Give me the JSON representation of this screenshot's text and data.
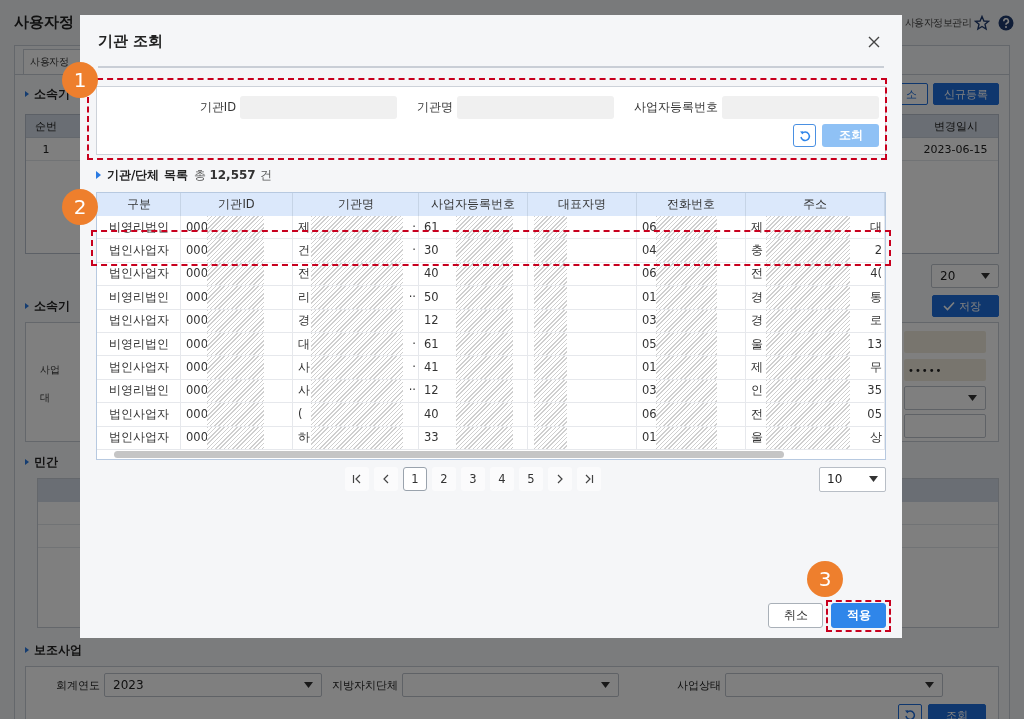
{
  "page": {
    "title": "사용자정",
    "breadcrumb": "사용자정보관리",
    "tab": {
      "label": "사용자정",
      "selected": true
    },
    "org_section": {
      "heading": "소속기",
      "buttons": [
        "소",
        "신규등록"
      ],
      "columns": [
        "순번",
        "변경일시"
      ],
      "row": [
        "1",
        "2023-06-15"
      ],
      "page_size": "20"
    },
    "detail_section": {
      "heading": "소속기",
      "save": "저장",
      "labels": [
        "사업",
        "대"
      ],
      "masked_value": "•••••"
    },
    "private_section": {
      "heading": "민간"
    },
    "subsidy_section": {
      "heading": "보조사업",
      "filters": [
        {
          "label": "회계연도",
          "value": "2023"
        },
        {
          "label": "지방자치단체"
        },
        {
          "label": "사업상태"
        }
      ],
      "search": "조회"
    }
  },
  "dialog": {
    "title": "기관 조회",
    "search": {
      "fields": [
        {
          "label": "기관ID"
        },
        {
          "label": "기관명"
        },
        {
          "label": "사업자등록번호"
        }
      ],
      "search_button": {
        "label": "조회",
        "disabled": true
      }
    },
    "list": {
      "heading": "기관/단체 목록",
      "total": "총 **12,557** 건",
      "columns": [
        "구분",
        "기관ID",
        "기관명",
        "사업자등록번호",
        "대표자명",
        "전화번호",
        "주소"
      ],
      "rows": [
        {
          "type": "비영리법인",
          "org_id": "000",
          "org_name": "제",
          "org_name_end": "·",
          "biz_no": "61",
          "phone": "06",
          "address": "제",
          "address_end": "대"
        },
        {
          "type": "법인사업자",
          "org_id": "000",
          "org_name": "건",
          "org_name_end": "·",
          "biz_no": "30",
          "phone": "04",
          "address": "충",
          "address_end": "2"
        },
        {
          "type": "법인사업자",
          "org_id": "000",
          "org_name": "전",
          "biz_no": "40",
          "phone": "06",
          "address": "전",
          "address_end": "4("
        },
        {
          "type": "비영리법인",
          "org_id": "000",
          "org_name": "리",
          "org_name_end": "··",
          "biz_no": "50",
          "phone": "01",
          "address": "경",
          "address_end": "통"
        },
        {
          "type": "법인사업자",
          "org_id": "000",
          "org_name": "경",
          "biz_no": "12",
          "phone": "03",
          "address": "경",
          "address_end": "로"
        },
        {
          "type": "비영리법인",
          "org_id": "000",
          "org_name": "대",
          "org_name_end": "·",
          "biz_no": "61",
          "phone": "05",
          "address": "울",
          "address_end": "13"
        },
        {
          "type": "법인사업자",
          "org_id": "000",
          "org_name": "사",
          "org_name_end": "·",
          "biz_no": "41",
          "phone": "01",
          "address": "제",
          "address_end": "무"
        },
        {
          "type": "비영리법인",
          "org_id": "000",
          "org_name": "사",
          "org_name_end": "··",
          "biz_no": "12",
          "phone": "03",
          "address": "인",
          "address_end": "35"
        },
        {
          "type": "법인사업자",
          "org_id": "000",
          "org_name": "(",
          "biz_no": "40",
          "phone": "06",
          "address": "전",
          "address_end": "05"
        },
        {
          "type": "법인사업자",
          "org_id": "000",
          "org_name": "하",
          "biz_no": "33",
          "phone": "01",
          "address": "울",
          "address_end": "상"
        }
      ]
    },
    "pagination": {
      "pages": [
        {
          "label": "1",
          "selected": true
        },
        {
          "label": "2",
          "selected": false
        },
        {
          "label": "3",
          "selected": false
        },
        {
          "label": "4",
          "selected": false
        },
        {
          "label": "5",
          "selected": false
        }
      ],
      "page_size": "10"
    },
    "buttons": [
      {
        "label": "취소",
        "kind": "secondary"
      },
      {
        "label": "적용",
        "kind": "primary"
      }
    ]
  },
  "annotations": [
    {
      "label": "1"
    },
    {
      "label": "2"
    },
    {
      "label": "3"
    }
  ]
}
